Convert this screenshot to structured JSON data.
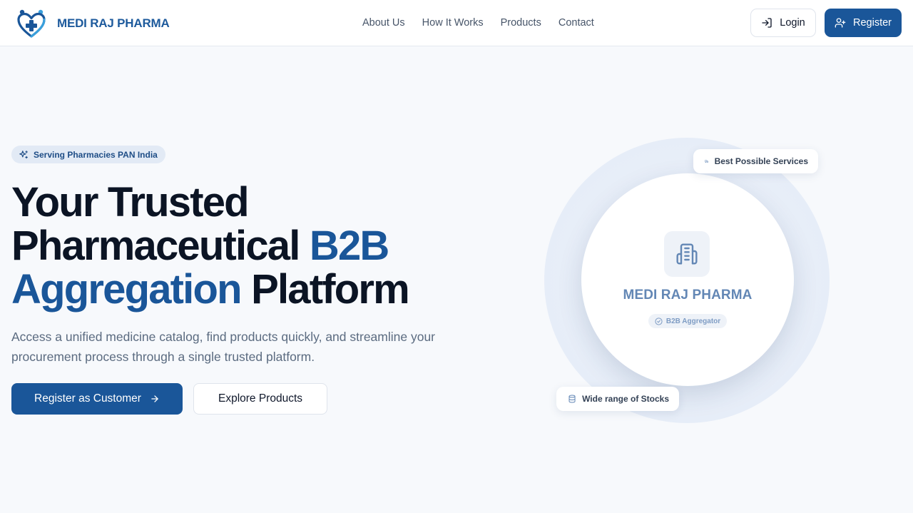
{
  "brand": {
    "name": "MEDI RAJ PHARMA",
    "logo_icon": "heart-medical-people-icon"
  },
  "nav": {
    "items": [
      "About Us",
      "How It Works",
      "Products",
      "Contact"
    ]
  },
  "auth": {
    "login_label": "Login",
    "login_icon": "login-arrow-icon",
    "register_label": "Register",
    "register_icon": "user-plus-icon"
  },
  "hero": {
    "badge": {
      "label": "Serving Pharmacies PAN India",
      "icon": "sparkles-icon"
    },
    "title": {
      "line1": "Your Trusted",
      "line2_plain": "Pharmaceutical ",
      "line2_accent": "B2B",
      "line3_accent": "Aggregation",
      "line3_plain": " Platform"
    },
    "subtitle": "Access a unified medicine catalog, find products quickly, and streamline your procurement process through a single trusted platform.",
    "primary_cta": "Register as Customer",
    "secondary_cta": "Explore Products"
  },
  "visual": {
    "card_title": "MEDI RAJ PHARMA",
    "card_badge": "B2B Aggregator",
    "card_icon": "building-icon",
    "chip_services": {
      "label": "Best Possible Services",
      "icon": "truck-icon"
    },
    "chip_stocks": {
      "label": "Wide range of Stocks",
      "icon": "database-icon"
    }
  },
  "colors": {
    "brand_blue": "#1a5699",
    "background": "#f7f9fc",
    "heading": "#0b1424",
    "muted_text": "#5b6b80",
    "badge_bg": "#e2eaf5"
  }
}
